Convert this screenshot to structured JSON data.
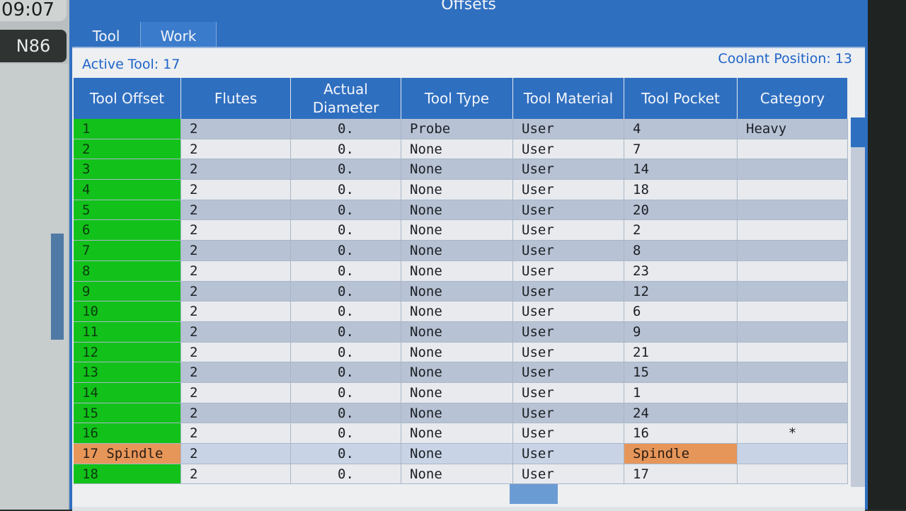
{
  "clock": "09:07",
  "n_line": "N86",
  "title": "Offsets",
  "tabs": [
    {
      "label": "Tool"
    },
    {
      "label": "Work"
    }
  ],
  "active_tool": "Active Tool: 17",
  "coolant_position": "Coolant Position: 13",
  "table": {
    "headers": {
      "tool_offset": "Tool Offset",
      "flutes": "Flutes",
      "actual_diameter": "Actual Diameter",
      "tool_type": "Tool Type",
      "tool_material": "Tool Material",
      "tool_pocket": "Tool Pocket",
      "category": "Category"
    },
    "rows": [
      {
        "offset": "1",
        "flutes": "2",
        "diameter": "0.",
        "type": "Probe",
        "material": "User",
        "pocket": "4",
        "category": "Heavy"
      },
      {
        "offset": "2",
        "flutes": "2",
        "diameter": "0.",
        "type": "None",
        "material": "User",
        "pocket": "7",
        "category": ""
      },
      {
        "offset": "3",
        "flutes": "2",
        "diameter": "0.",
        "type": "None",
        "material": "User",
        "pocket": "14",
        "category": ""
      },
      {
        "offset": "4",
        "flutes": "2",
        "diameter": "0.",
        "type": "None",
        "material": "User",
        "pocket": "18",
        "category": ""
      },
      {
        "offset": "5",
        "flutes": "2",
        "diameter": "0.",
        "type": "None",
        "material": "User",
        "pocket": "20",
        "category": ""
      },
      {
        "offset": "6",
        "flutes": "2",
        "diameter": "0.",
        "type": "None",
        "material": "User",
        "pocket": "2",
        "category": ""
      },
      {
        "offset": "7",
        "flutes": "2",
        "diameter": "0.",
        "type": "None",
        "material": "User",
        "pocket": "8",
        "category": ""
      },
      {
        "offset": "8",
        "flutes": "2",
        "diameter": "0.",
        "type": "None",
        "material": "User",
        "pocket": "23",
        "category": ""
      },
      {
        "offset": "9",
        "flutes": "2",
        "diameter": "0.",
        "type": "None",
        "material": "User",
        "pocket": "12",
        "category": ""
      },
      {
        "offset": "10",
        "flutes": "2",
        "diameter": "0.",
        "type": "None",
        "material": "User",
        "pocket": "6",
        "category": ""
      },
      {
        "offset": "11",
        "flutes": "2",
        "diameter": "0.",
        "type": "None",
        "material": "User",
        "pocket": "9",
        "category": ""
      },
      {
        "offset": "12",
        "flutes": "2",
        "diameter": "0.",
        "type": "None",
        "material": "User",
        "pocket": "21",
        "category": ""
      },
      {
        "offset": "13",
        "flutes": "2",
        "diameter": "0.",
        "type": "None",
        "material": "User",
        "pocket": "15",
        "category": ""
      },
      {
        "offset": "14",
        "flutes": "2",
        "diameter": "0.",
        "type": "None",
        "material": "User",
        "pocket": "1",
        "category": ""
      },
      {
        "offset": "15",
        "flutes": "2",
        "diameter": "0.",
        "type": "None",
        "material": "User",
        "pocket": "24",
        "category": ""
      },
      {
        "offset": "16",
        "flutes": "2",
        "diameter": "0.",
        "type": "None",
        "material": "User",
        "pocket": "16",
        "category": "*"
      },
      {
        "offset": "17 Spindle",
        "flutes": "2",
        "diameter": "0.",
        "type": "None",
        "material": "User",
        "pocket": "Spindle",
        "category": ""
      },
      {
        "offset": "18",
        "flutes": "2",
        "diameter": "0.",
        "type": "None",
        "material": "User",
        "pocket": "17",
        "category": ""
      }
    ]
  },
  "colors": {
    "header_blue": "#2f6fc0",
    "offset_green": "#12c21a",
    "active_orange": "#e7965a",
    "label_blue": "#1e63c8"
  }
}
